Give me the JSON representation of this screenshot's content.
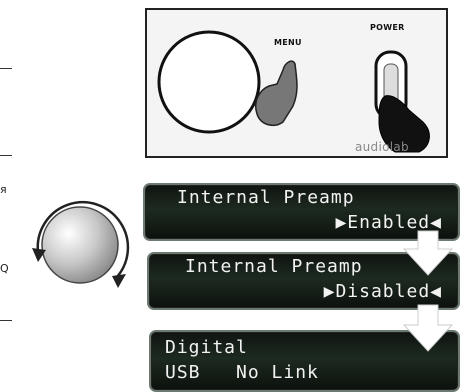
{
  "device": {
    "menu_label": "MENU",
    "power_label": "POWER",
    "brand_label": "audiolab"
  },
  "margin": {
    "char_1": "я",
    "char_2": "Q"
  },
  "screens": [
    {
      "line1": "Internal Preamp",
      "line2": "▶Enabled◀"
    },
    {
      "line1": "Internal Preamp",
      "line2": "▶Disabled◀"
    },
    {
      "line1": "Digital",
      "line2": "USB   No Link"
    }
  ],
  "colors": {
    "lcd_bg": "#16201a",
    "lcd_text": "#f2f2f2",
    "arrow": "#ffffff"
  }
}
